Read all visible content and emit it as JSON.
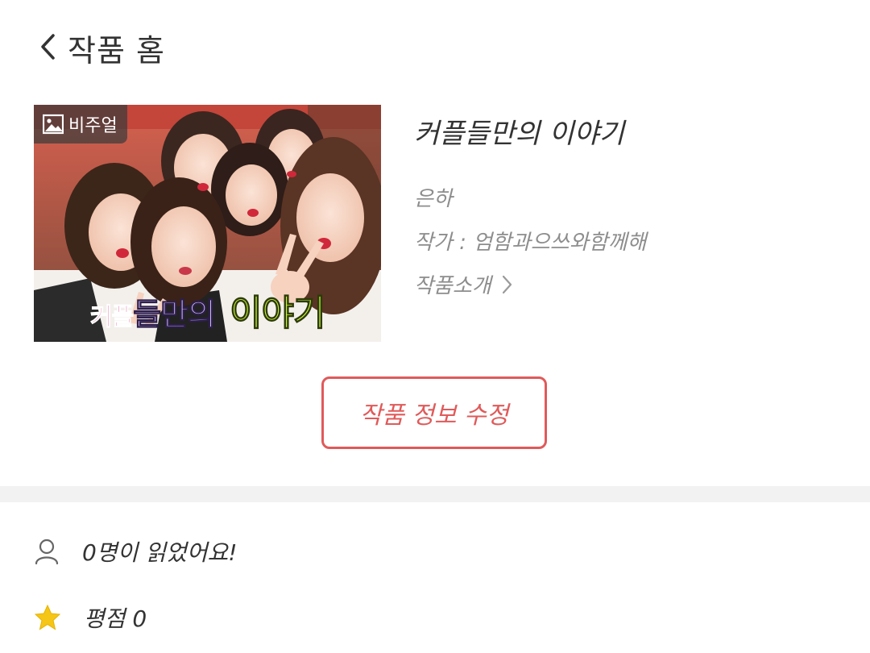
{
  "header": {
    "title": "작품 홈",
    "back_icon": "chevron-left-icon"
  },
  "work": {
    "visual_badge": "비주얼",
    "cover_caption_parts": [
      "커플",
      "들만의",
      "이야기"
    ],
    "title": "커플들만의 이야기",
    "subtitle": "은하",
    "author_line": "작가 : 엄함과으쓰와함께해",
    "intro_link": "작품소개"
  },
  "actions": {
    "edit_label": "작품 정보 수정"
  },
  "stats": {
    "readers": "0명이 읽었어요!",
    "rating": "평점 0"
  },
  "colors": {
    "accent": "#e05a5a",
    "divider": "#f2f2f2",
    "star": "#f5c518"
  }
}
